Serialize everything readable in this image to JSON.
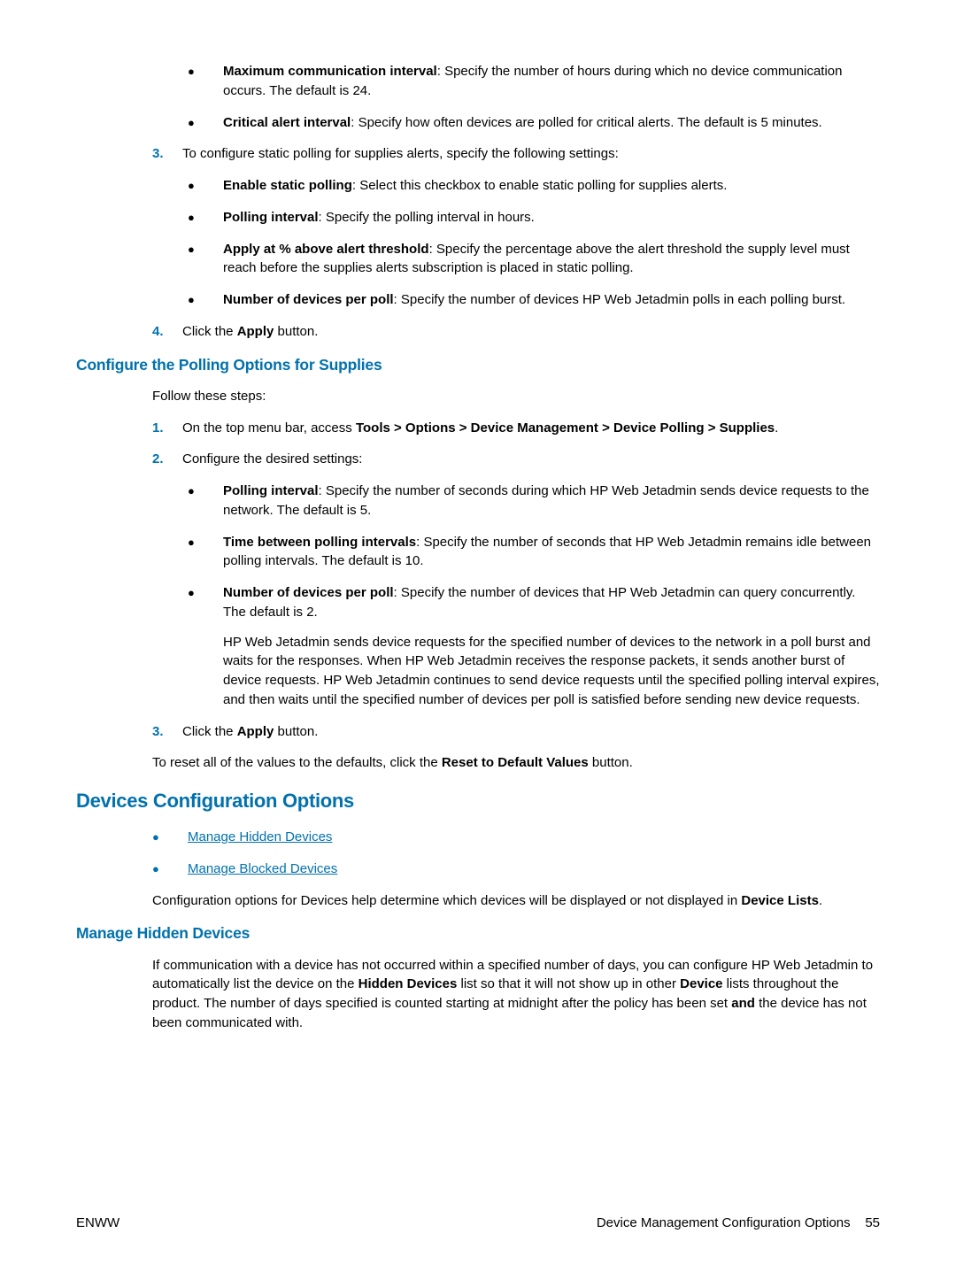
{
  "top_bullets": [
    {
      "bold": "Maximum communication interval",
      "text": ": Specify the number of hours during which no device communication occurs. The default is 24."
    },
    {
      "bold": "Critical alert interval",
      "text": ": Specify how often devices are polled for critical alerts. The default is 5 minutes."
    }
  ],
  "step3": {
    "num": "3.",
    "intro": "To configure static polling for supplies alerts, specify the following settings:",
    "bullets": [
      {
        "bold": "Enable static polling",
        "text": ": Select this checkbox to enable static polling for supplies alerts."
      },
      {
        "bold": "Polling interval",
        "text": ": Specify the polling interval in hours."
      },
      {
        "bold": "Apply at % above alert threshold",
        "text": ": Specify the percentage above the alert threshold the supply level must reach before the supplies alerts subscription is placed in static polling."
      },
      {
        "bold": "Number of devices per poll",
        "text": ": Specify the number of devices HP Web Jetadmin polls in each polling burst."
      }
    ]
  },
  "step4": {
    "num": "4.",
    "pre": "Click the ",
    "bold": "Apply",
    "post": " button."
  },
  "configure_polling": {
    "heading": "Configure the Polling Options for Supplies",
    "follow": "Follow these steps:",
    "step1": {
      "num": "1.",
      "pre": "On the top menu bar, access ",
      "bold": "Tools > Options > Device Management > Device Polling > Supplies",
      "post": "."
    },
    "step2": {
      "num": "2.",
      "text": "Configure the desired settings:",
      "bullets": [
        {
          "bold": "Polling interval",
          "text": ": Specify the number of seconds during which HP Web Jetadmin sends device requests to the network. The default is 5."
        },
        {
          "bold": "Time between polling intervals",
          "text": ": Specify the number of seconds that HP Web Jetadmin remains idle between polling intervals. The default is 10."
        },
        {
          "bold": "Number of devices per poll",
          "text": ": Specify the number of devices that HP Web Jetadmin can query concurrently. The default is 2.",
          "extra": "HP Web Jetadmin sends device requests for the specified number of devices to the network in a poll burst and waits for the responses. When HP Web Jetadmin receives the response packets, it sends another burst of device requests. HP Web Jetadmin continues to send device requests until the specified polling interval expires, and then waits until the specified number of devices per poll is satisfied before sending new device requests."
        }
      ]
    },
    "step3": {
      "num": "3.",
      "pre": "Click the ",
      "bold": "Apply",
      "post": " button."
    },
    "reset": {
      "pre": "To reset all of the values to the defaults, click the ",
      "bold": "Reset to Default Values",
      "post": " button."
    }
  },
  "devices_config": {
    "heading": "Devices Configuration Options",
    "links": [
      "Manage Hidden Devices",
      "Manage Blocked Devices"
    ],
    "intro": {
      "pre": "Configuration options for Devices help determine which devices will be displayed or not displayed in ",
      "bold": "Device Lists",
      "post": "."
    }
  },
  "manage_hidden": {
    "heading": "Manage Hidden Devices",
    "p1_a": "If communication with a device has not occurred within a specified number of days, you can configure HP Web Jetadmin to automatically list the device on the ",
    "p1_b": "Hidden Devices",
    "p1_c": " list so that it will not show up in other ",
    "p1_d": "Device",
    "p1_e": " lists throughout the product. The number of days specified is counted starting at midnight after the policy has been set ",
    "p1_f": "and",
    "p1_g": " the device has not been communicated with."
  },
  "footer": {
    "left": "ENWW",
    "right_text": "Device Management Configuration Options",
    "right_page": "55"
  }
}
